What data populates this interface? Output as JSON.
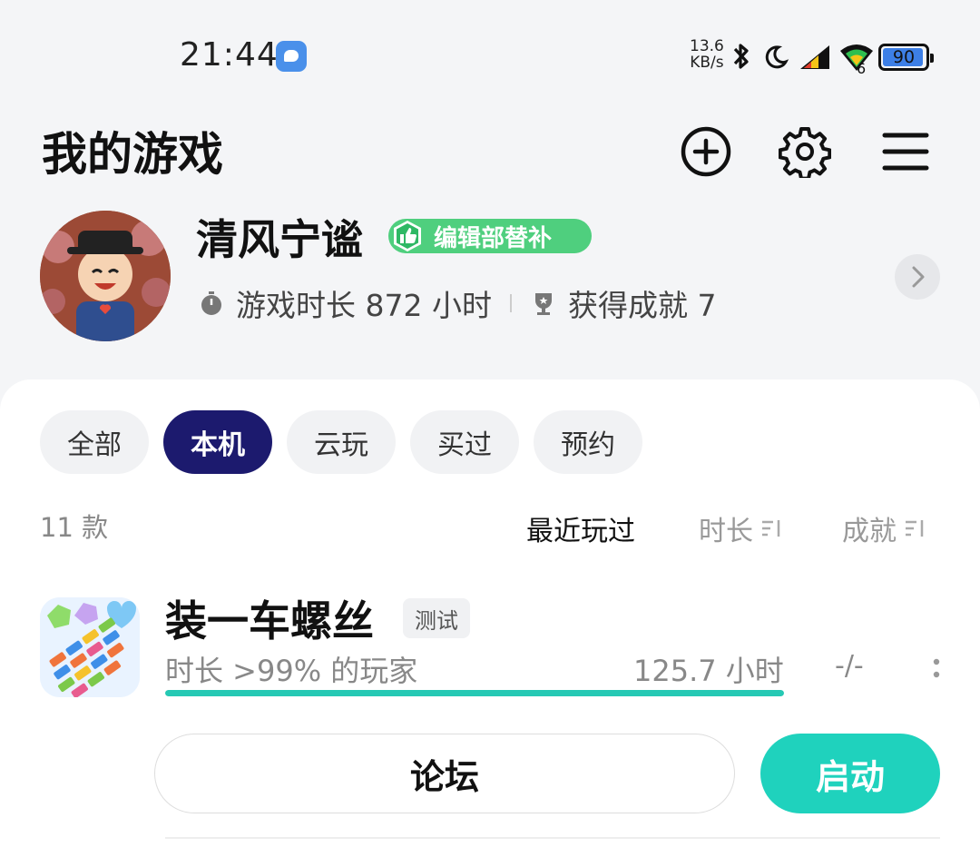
{
  "status_bar": {
    "time": "21:44",
    "net_speed_value": "13.6",
    "net_speed_unit": "KB/s",
    "battery_level": "90",
    "wifi_sub": "6",
    "icons": [
      "message-app-icon",
      "bluetooth-icon",
      "moon-icon",
      "signal-icon",
      "wifi-icon",
      "battery-icon"
    ]
  },
  "header": {
    "title": "我的游戏",
    "icons": [
      "add-circle-icon",
      "gear-icon",
      "menu-icon"
    ]
  },
  "profile": {
    "username": "清风宁谧",
    "badge": "编辑部替补",
    "playtime_label": "游戏时长 872 小时",
    "achievements_label": "获得成就 7"
  },
  "tabs": [
    {
      "label": "全部",
      "active": false
    },
    {
      "label": "本机",
      "active": true
    },
    {
      "label": "云玩",
      "active": false
    },
    {
      "label": "买过",
      "active": false
    },
    {
      "label": "预约",
      "active": false
    }
  ],
  "list": {
    "count": "11 款",
    "sort": {
      "recent": "最近玩过",
      "duration": "时长",
      "achievements": "成就"
    }
  },
  "game": {
    "name": "装一车螺丝",
    "tag": "测试",
    "duration_rank": "时长 >99% 的玩家",
    "hours": "125.7 小时",
    "achievement_ratio": "-/-",
    "progress": 1.0,
    "forum_label": "论坛",
    "launch_label": "启动"
  },
  "colors": {
    "accent": "#1fd2bd",
    "tab_active": "#1c1a6e",
    "badge": "#4fcf7e"
  }
}
